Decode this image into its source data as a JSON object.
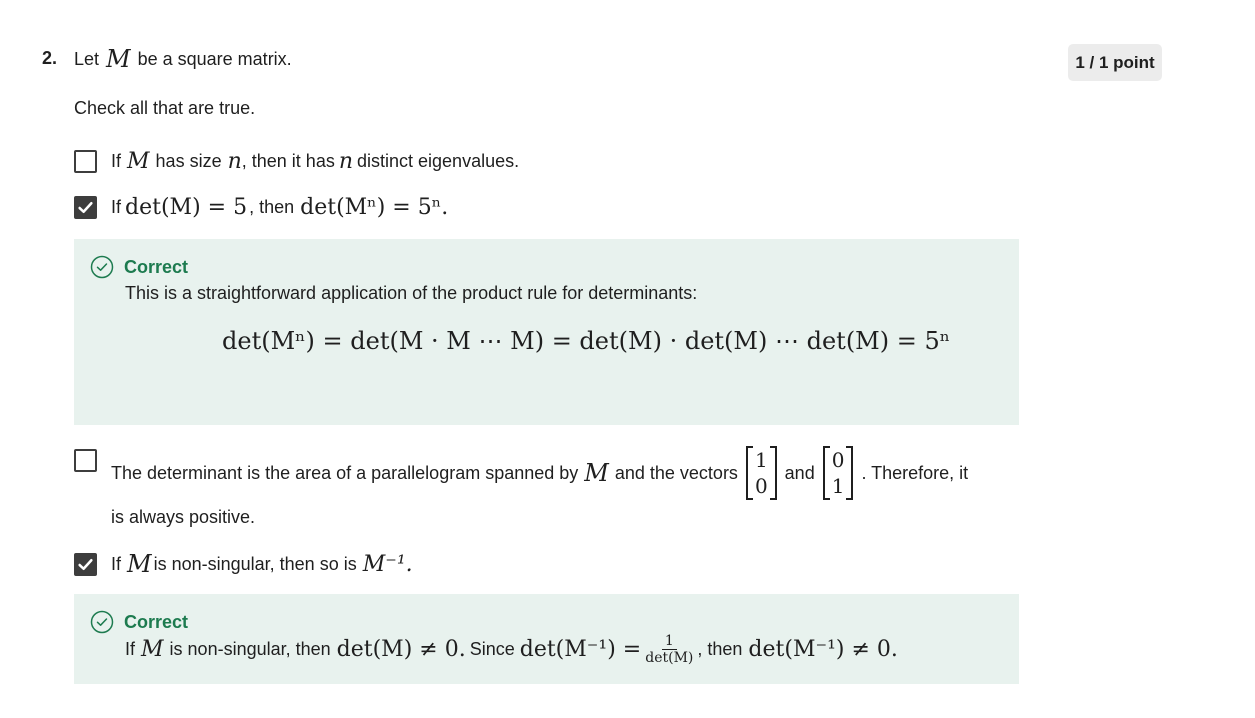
{
  "question": {
    "number": "2.",
    "points": "1 / 1 point",
    "stem_prefix": "Let",
    "stem_var": "M",
    "stem_suffix": "be a square matrix.",
    "instruction": "Check all that are true."
  },
  "options": [
    {
      "checked": false,
      "parts": [
        "If",
        "M",
        "has size",
        "n",
        ", then it has",
        "n",
        "distinct eigenvalues."
      ]
    },
    {
      "checked": true,
      "parts": [
        "If",
        "det(M) = 5",
        ", then",
        "det(Mⁿ) = 5ⁿ."
      ]
    },
    {
      "checked": false,
      "parts": [
        "The determinant is the area of a parallelogram spanned by",
        "M",
        "and the vectors",
        "and",
        ". Therefore, it",
        "is always positive."
      ],
      "vector1": [
        "1",
        "0"
      ],
      "vector2": [
        "0",
        "1"
      ]
    },
    {
      "checked": true,
      "parts": [
        "If",
        "M",
        "is non-singular, then so is",
        "M⁻¹."
      ]
    }
  ],
  "feedback": [
    {
      "title": "Correct",
      "text": "This is a straightforward application of the product rule for determinants:",
      "math": "det(Mⁿ) = det(M · M ⋯ M) = det(M) · det(M) ⋯ det(M) = 5ⁿ"
    },
    {
      "title": "Correct",
      "parts": [
        "If",
        "M",
        "is non-singular, then",
        "det(M) ≠ 0.",
        "Since",
        "det(M⁻¹) =",
        "1",
        "det(M)",
        ", then",
        "det(M⁻¹) ≠ 0."
      ]
    }
  ],
  "colors": {
    "correct": "#1d7b4f",
    "feedback_bg": "#e8f2ee",
    "checkbox": "#3d3d3d"
  }
}
